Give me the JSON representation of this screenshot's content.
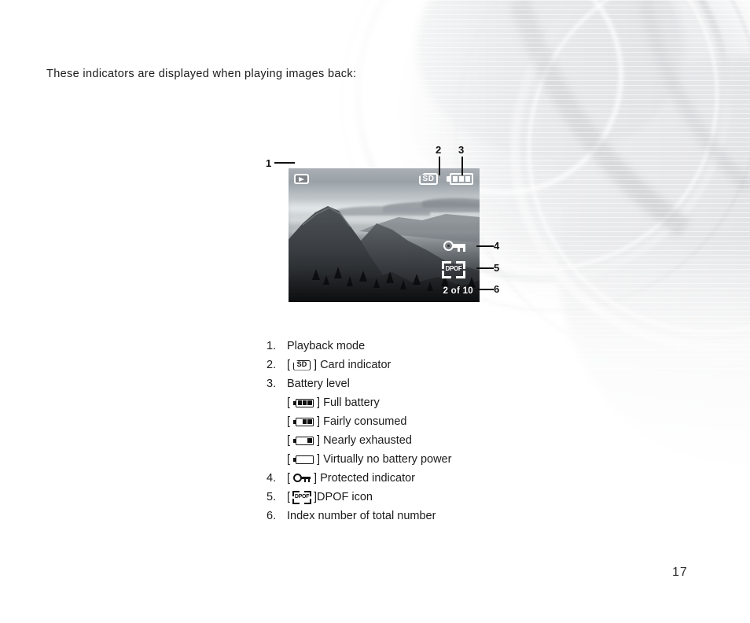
{
  "page": {
    "intro_text": "These indicators are displayed when playing images back:",
    "page_number": "17"
  },
  "figure": {
    "osd": {
      "playback_icon_name": "playback-mode-icon",
      "card_label": "SD",
      "battery_icon_name": "battery-full-icon",
      "protect_icon_name": "protected-key-icon",
      "dpof_label": "DPOF",
      "counter_text": "2 of 10"
    },
    "callouts": [
      {
        "number": "1",
        "target": "playback-mode-icon"
      },
      {
        "number": "2",
        "target": "card-indicator-icon"
      },
      {
        "number": "3",
        "target": "battery-level-icon"
      },
      {
        "number": "4",
        "target": "protected-indicator-icon"
      },
      {
        "number": "5",
        "target": "dpof-icon"
      },
      {
        "number": "6",
        "target": "index-counter"
      }
    ]
  },
  "legend": {
    "items": [
      {
        "num": "1.",
        "label": "Playback mode",
        "icon": null
      },
      {
        "num": "2.",
        "pre": "[",
        "post": "] Card indicator",
        "icon": "sd-card-icon",
        "icon_label": "SD"
      },
      {
        "num": "3.",
        "label": "Battery level",
        "icon": null
      },
      {
        "num": "",
        "pre": "[",
        "post": "] Full battery",
        "icon": "battery-full-icon",
        "bars": 3
      },
      {
        "num": "",
        "pre": "[",
        "post": "] Fairly consumed",
        "icon": "battery-two-thirds-icon",
        "bars": 2
      },
      {
        "num": "",
        "pre": "[",
        "post": "] Nearly exhausted",
        "icon": "battery-low-icon",
        "bars": 1
      },
      {
        "num": "",
        "pre": "[",
        "post": "] Virtually no battery power",
        "icon": "battery-empty-icon",
        "bars": 0
      },
      {
        "num": "4.",
        "pre": "[",
        "post": "] Protected indicator",
        "icon": "protected-key-icon"
      },
      {
        "num": "5.",
        "pre": "[",
        "post": "]DPOF icon",
        "icon": "dpof-icon",
        "icon_label": "DPOF"
      },
      {
        "num": "6.",
        "label": "Index number of total number",
        "icon": null
      }
    ]
  },
  "colors": {
    "text": "#1b1b1b",
    "page_background": "#ffffff",
    "osd_foreground": "#ffffff",
    "callout": "#111111"
  }
}
